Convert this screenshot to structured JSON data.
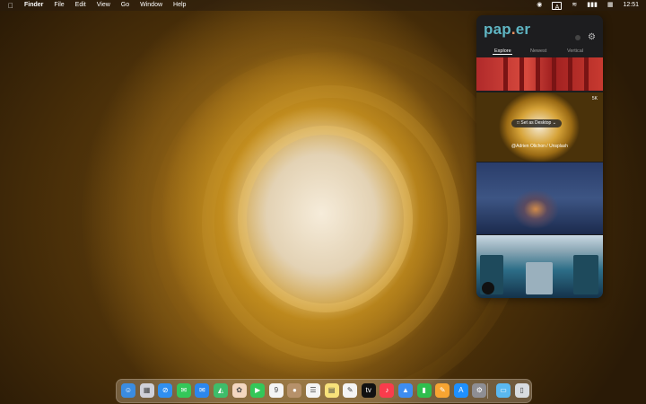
{
  "menubar": {
    "apple_glyph": "",
    "app_name": "Finder",
    "menus": [
      "File",
      "Edit",
      "View",
      "Go",
      "Window",
      "Help"
    ],
    "status": {
      "input_badge": "A",
      "time": "12:51"
    }
  },
  "paper_app": {
    "logo_main": "pap",
    "logo_dot": ".",
    "logo_tail": "er",
    "tabs": [
      "Explore",
      "Newest",
      "Vertical"
    ],
    "active_tab": "Explore",
    "wallpapers": [
      {
        "id": "w1"
      },
      {
        "id": "w2",
        "badge": "5K",
        "action": "Set as Desktop",
        "credit": "@Adrien Olichon / Unsplash"
      },
      {
        "id": "w3"
      },
      {
        "id": "w4"
      }
    ]
  },
  "dock": {
    "apps": [
      {
        "name": "finder-icon",
        "color": "#3b8ce0",
        "glyph": "☺"
      },
      {
        "name": "launchpad-icon",
        "color": "#d0d0d8",
        "glyph": "▦"
      },
      {
        "name": "safari-icon",
        "color": "#2f8ff0",
        "glyph": "⊘"
      },
      {
        "name": "messages-icon",
        "color": "#34c759",
        "glyph": "✉"
      },
      {
        "name": "mail-icon",
        "color": "#2b87ee",
        "glyph": "✉"
      },
      {
        "name": "maps-icon",
        "color": "#3ebd6a",
        "glyph": "◭"
      },
      {
        "name": "photos-icon",
        "color": "#f4d7c0",
        "glyph": "✿"
      },
      {
        "name": "facetime-icon",
        "color": "#34c759",
        "glyph": "▶"
      },
      {
        "name": "calendar-icon",
        "color": "#f4f4f4",
        "glyph": "9"
      },
      {
        "name": "contacts-icon",
        "color": "#b6916a",
        "glyph": "●"
      },
      {
        "name": "reminders-icon",
        "color": "#f4f4f4",
        "glyph": "☰"
      },
      {
        "name": "notes-icon",
        "color": "#f8e27a",
        "glyph": "▤"
      },
      {
        "name": "freeform-icon",
        "color": "#f4f4f4",
        "glyph": "✎"
      },
      {
        "name": "tv-icon",
        "color": "#111111",
        "glyph": "tv"
      },
      {
        "name": "music-icon",
        "color": "#fa3c4c",
        "glyph": "♪"
      },
      {
        "name": "keynote-icon",
        "color": "#3e8df2",
        "glyph": "▲"
      },
      {
        "name": "numbers-icon",
        "color": "#2fbe4e",
        "glyph": "▮"
      },
      {
        "name": "pages-icon",
        "color": "#f7a431",
        "glyph": "✎"
      },
      {
        "name": "appstore-icon",
        "color": "#1e90ff",
        "glyph": "A"
      },
      {
        "name": "settings-icon",
        "color": "#8e8e93",
        "glyph": "⚙"
      },
      {
        "name": "downloads-folder-icon",
        "color": "#5ab8f0",
        "glyph": "▭"
      },
      {
        "name": "trash-icon",
        "color": "#d8dce0",
        "glyph": "▯"
      }
    ],
    "calendar_day": "9"
  }
}
